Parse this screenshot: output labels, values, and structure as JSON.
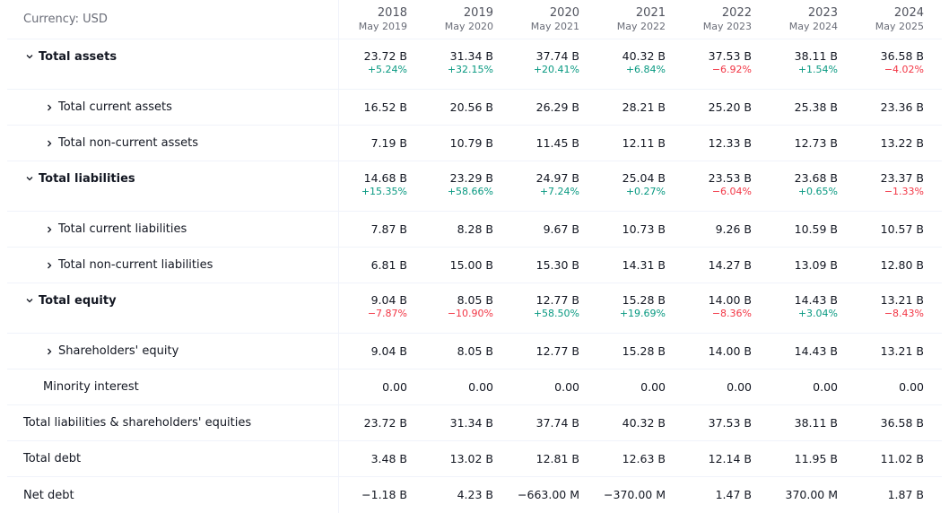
{
  "header": {
    "currency_label": "Currency: USD",
    "columns": [
      {
        "year": "2018",
        "period": "May 2019"
      },
      {
        "year": "2019",
        "period": "May 2020"
      },
      {
        "year": "2020",
        "period": "May 2021"
      },
      {
        "year": "2021",
        "period": "May 2022"
      },
      {
        "year": "2022",
        "period": "May 2023"
      },
      {
        "year": "2023",
        "period": "May 2024"
      },
      {
        "year": "2024",
        "period": "May 2025"
      }
    ]
  },
  "rows": [
    {
      "label": "Total assets",
      "values": [
        "23.72 B",
        "31.34 B",
        "37.74 B",
        "40.32 B",
        "37.53 B",
        "38.11 B",
        "36.58 B"
      ],
      "changes": [
        "+5.24%",
        "+32.15%",
        "+20.41%",
        "+6.84%",
        "−6.92%",
        "+1.54%",
        "−4.02%"
      ]
    },
    {
      "label": "Total current assets",
      "values": [
        "16.52 B",
        "20.56 B",
        "26.29 B",
        "28.21 B",
        "25.20 B",
        "25.38 B",
        "23.36 B"
      ]
    },
    {
      "label": "Total non-current assets",
      "values": [
        "7.19 B",
        "10.79 B",
        "11.45 B",
        "12.11 B",
        "12.33 B",
        "12.73 B",
        "13.22 B"
      ]
    },
    {
      "label": "Total liabilities",
      "values": [
        "14.68 B",
        "23.29 B",
        "24.97 B",
        "25.04 B",
        "23.53 B",
        "23.68 B",
        "23.37 B"
      ],
      "changes": [
        "+15.35%",
        "+58.66%",
        "+7.24%",
        "+0.27%",
        "−6.04%",
        "+0.65%",
        "−1.33%"
      ]
    },
    {
      "label": "Total current liabilities",
      "values": [
        "7.87 B",
        "8.28 B",
        "9.67 B",
        "10.73 B",
        "9.26 B",
        "10.59 B",
        "10.57 B"
      ]
    },
    {
      "label": "Total non-current liabilities",
      "values": [
        "6.81 B",
        "15.00 B",
        "15.30 B",
        "14.31 B",
        "14.27 B",
        "13.09 B",
        "12.80 B"
      ]
    },
    {
      "label": "Total equity",
      "values": [
        "9.04 B",
        "8.05 B",
        "12.77 B",
        "15.28 B",
        "14.00 B",
        "14.43 B",
        "13.21 B"
      ],
      "changes": [
        "−7.87%",
        "−10.90%",
        "+58.50%",
        "+19.69%",
        "−8.36%",
        "+3.04%",
        "−8.43%"
      ]
    },
    {
      "label": "Shareholders' equity",
      "values": [
        "9.04 B",
        "8.05 B",
        "12.77 B",
        "15.28 B",
        "14.00 B",
        "14.43 B",
        "13.21 B"
      ]
    },
    {
      "label": "Minority interest",
      "values": [
        "0.00",
        "0.00",
        "0.00",
        "0.00",
        "0.00",
        "0.00",
        "0.00"
      ]
    },
    {
      "label": "Total liabilities & shareholders' equities",
      "values": [
        "23.72 B",
        "31.34 B",
        "37.74 B",
        "40.32 B",
        "37.53 B",
        "38.11 B",
        "36.58 B"
      ]
    },
    {
      "label": "Total debt",
      "values": [
        "3.48 B",
        "13.02 B",
        "12.81 B",
        "12.63 B",
        "12.14 B",
        "11.95 B",
        "11.02 B"
      ]
    },
    {
      "label": "Net debt",
      "values": [
        "−1.18 B",
        "4.23 B",
        "−663.00 M",
        "−370.00 M",
        "1.47 B",
        "370.00 M",
        "1.87 B"
      ]
    }
  ],
  "colors": {
    "positive": "#089981",
    "negative": "#f23645",
    "divider": "#f0f3fa"
  },
  "icons": {
    "expanded": "chevron-down-icon",
    "collapsed": "chevron-right-icon"
  }
}
